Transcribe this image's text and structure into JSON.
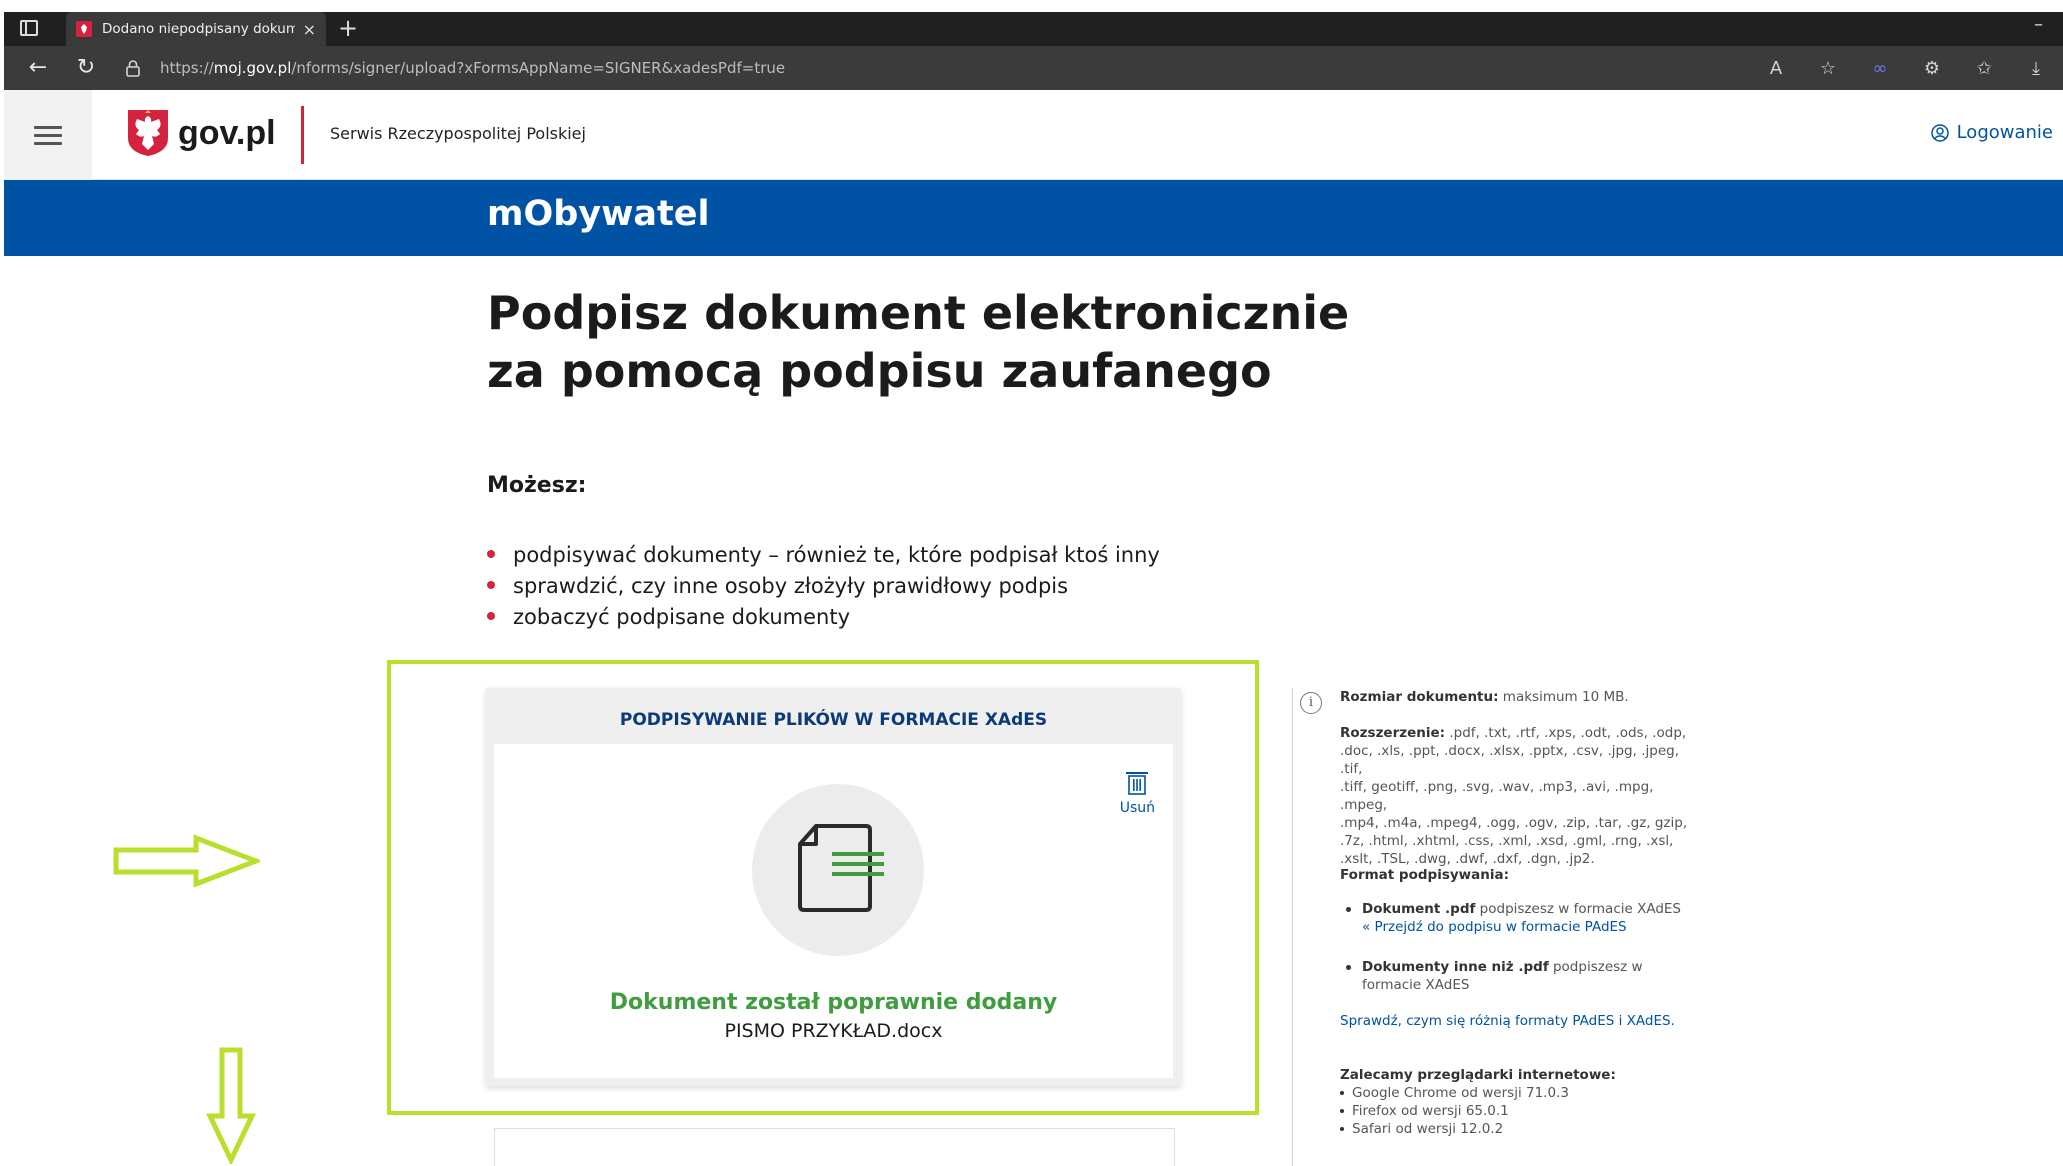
{
  "browser": {
    "tab_title": "Dodano niepodpisany dokument",
    "url_prefix": "https://",
    "url_host": "moj.gov.pl",
    "url_path": "/nforms/signer/upload?xFormsAppName=SIGNER&xadesPdf=true"
  },
  "header": {
    "brand": "gov.pl",
    "serwis": "Serwis Rzeczypospolitej Polskiej",
    "login": "Logowanie"
  },
  "service": {
    "title": "mObywatel"
  },
  "main": {
    "title_line1": "Podpisz dokument elektronicznie",
    "title_line2": "za pomocą podpisu zaufanego",
    "mozesz": "Możesz:",
    "bullets": [
      "podpisywać dokumenty – również te, które podpisał ktoś inny",
      "sprawdzić, czy inne osoby złożyły prawidłowy podpis",
      "zobaczyć podpisane dokumenty"
    ]
  },
  "upload": {
    "card_title": "PODPISYWANIE PLIKÓW W FORMACIE XAdES",
    "delete_label": "Usuń",
    "success": "Dokument został poprawnie dodany",
    "filename": "PISMO PRZYKŁAD.docx",
    "success_color": "#3f9d3f"
  },
  "side": {
    "size_label": "Rozmiar dokumentu:",
    "size_value": " maksimum 10 MB.",
    "ext_label": "Rozszerzenie:",
    "ext_lines": [
      " .pdf, .txt, .rtf, .xps, .odt, .ods, .odp,",
      ".doc, .xls, .ppt, .docx, .xlsx, .pptx, .csv, .jpg, .jpeg, .tif,",
      ".tiff, geotiff, .png, .svg, .wav, .mp3, .avi, .mpg, .mpeg,",
      ".mp4, .m4a, .mpeg4, .ogg, .ogv, .zip, .tar, .gz, gzip,",
      ".7z, .html, .xhtml, .css, .xml, .xsd, .gml, .rng, .xsl,",
      ".xslt, .TSL, .dwg, .dwf, .dxf, .dgn, .jp2."
    ],
    "format_heading": "Format podpisywania:",
    "format_items": [
      {
        "bold": "Dokument .pdf",
        "rest": " podpiszesz w formacie XAdES",
        "link": "« Przejdź do podpisu w formacie PAdES"
      },
      {
        "bold": "Dokumenty inne niż .pdf",
        "rest": " podpiszesz w formacie XAdES",
        "link": ""
      }
    ],
    "compare_link": "Sprawdź, czym się różnią formaty PAdES i XAdES.",
    "browsers_heading": "Zalecamy przeglądarki internetowe:",
    "browsers": [
      "Google Chrome od wersji 71.0.3",
      "Firefox od wersji 65.0.1",
      "Safari od wersji 12.0.2"
    ]
  },
  "colors": {
    "brand_blue": "#0052a5",
    "accent_red": "#d5233f",
    "annotation_green": "#b9de2c"
  },
  "icons": {
    "tab_favicon": "eagle-icon",
    "back": "back-arrow-icon",
    "reload": "reload-icon",
    "lock": "lock-icon",
    "menu": "hamburger-icon",
    "login": "user-circle-icon",
    "delete": "trash-icon",
    "document": "document-icon",
    "info": "info-icon"
  }
}
